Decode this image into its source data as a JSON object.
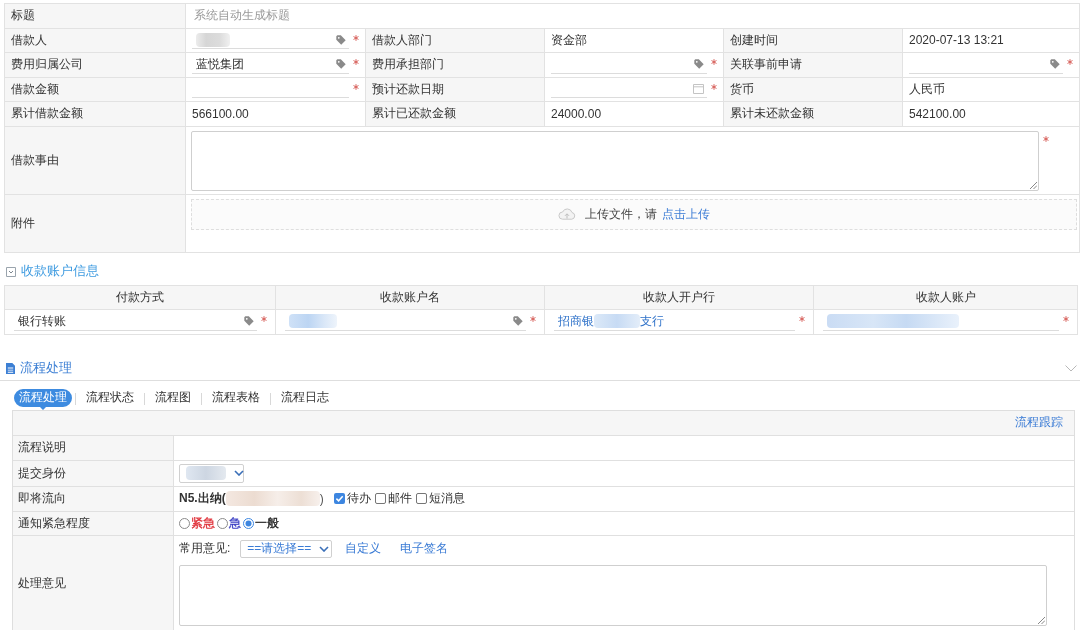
{
  "form": {
    "rows": [
      {
        "fields": [
          {
            "label": "标题",
            "kind": "static",
            "placeholder": "系统自动生成标题"
          }
        ]
      },
      {
        "fields": [
          {
            "label": "借款人",
            "kind": "lookup",
            "redacted": true,
            "required": true
          },
          {
            "label": "借款人部门",
            "kind": "static",
            "value": "资金部"
          },
          {
            "label": "创建时间",
            "kind": "static",
            "value": "2020-07-13 13:21"
          }
        ]
      },
      {
        "fields": [
          {
            "label": "费用归属公司",
            "kind": "lookup",
            "value": "蓝悦集团",
            "required": true
          },
          {
            "label": "费用承担部门",
            "kind": "lookup",
            "required": true
          },
          {
            "label": "关联事前申请",
            "kind": "lookup",
            "required": true
          }
        ]
      },
      {
        "fields": [
          {
            "label": "借款金额",
            "kind": "input",
            "required": true
          },
          {
            "label": "预计还款日期",
            "kind": "date",
            "required": true
          },
          {
            "label": "货币",
            "kind": "static",
            "value": "人民币"
          }
        ]
      },
      {
        "fields": [
          {
            "label": "累计借款金额",
            "kind": "static",
            "value": "566100.00"
          },
          {
            "label": "累计已还款金额",
            "kind": "static",
            "value": "24000.00"
          },
          {
            "label": "累计未还款金额",
            "kind": "static",
            "value": "542100.00"
          }
        ]
      },
      {
        "fields": [
          {
            "label": "借款事由",
            "kind": "textarea",
            "required": true
          }
        ]
      },
      {
        "fields": [
          {
            "label": "附件",
            "kind": "upload",
            "text": "上传文件，请",
            "link": "点击上传"
          }
        ]
      }
    ]
  },
  "account_section": {
    "title": "收款账户信息",
    "columns": [
      "付款方式",
      "收款账户名",
      "收款人开户行",
      "收款人账户"
    ],
    "cells": [
      {
        "kind": "lookup",
        "value": "银行转账",
        "required": true
      },
      {
        "kind": "lookup",
        "redacted": true,
        "required": true
      },
      {
        "kind": "input",
        "value": "招商银",
        "redacted": true,
        "suffix": "支行",
        "required": true
      },
      {
        "kind": "input",
        "redacted": true,
        "required": true
      }
    ]
  },
  "process_section": {
    "title": "流程处理",
    "tabs": [
      {
        "label": "流程处理",
        "selected": true
      },
      {
        "label": "流程状态",
        "selected": false
      },
      {
        "label": "流程图",
        "selected": false
      },
      {
        "label": "流程表格",
        "selected": false
      },
      {
        "label": "流程日志",
        "selected": false
      }
    ],
    "trace_link": "流程跟踪",
    "rows": [
      {
        "label": "流程说明",
        "kind": "empty"
      },
      {
        "label": "提交身份",
        "kind": "select",
        "redacted": true
      },
      {
        "label": "即将流向",
        "kind": "route",
        "value": "N5.出纳(",
        "redacted": true,
        "suffix": ")",
        "options": [
          {
            "label": "待办",
            "checked": true
          },
          {
            "label": "邮件",
            "checked": false
          },
          {
            "label": "短消息",
            "checked": false
          }
        ]
      },
      {
        "label": "通知紧急程度",
        "kind": "urgency",
        "options": [
          {
            "label": "紧急",
            "selected": false,
            "color": "#e0323a"
          },
          {
            "label": "急",
            "selected": false,
            "color": "#3b3fc4"
          },
          {
            "label": "一般",
            "selected": true,
            "color": "#222222"
          }
        ]
      },
      {
        "label": "处理意见",
        "kind": "opinion",
        "prompt": "常用意见:",
        "select_value": "==请选择==",
        "links": [
          "自定义",
          "电子签名"
        ]
      }
    ]
  }
}
